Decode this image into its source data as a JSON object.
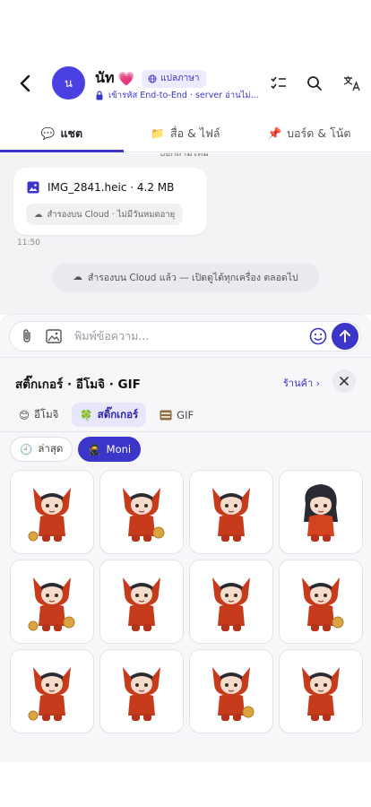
{
  "header": {
    "avatar_initial": "น",
    "contact_name": "นัท",
    "heart": "💗",
    "translate_label": "แปลภาษา",
    "encryption_text": "เข้ารหัส End-to-End · server อ่านไม่..."
  },
  "tabs": [
    {
      "icon": "💬",
      "label": "แชต"
    },
    {
      "icon": "📁",
      "label": "สื่อ & ไฟล์"
    },
    {
      "icon": "📌",
      "label": "บอร์ด & โน้ต"
    }
  ],
  "chat": {
    "cut_text": "บอกสามีไหม",
    "file_name": "IMG_2841.heic · 4.2 MB",
    "cloud_chip": "สำรองบน Cloud · ไม่มีวันหมดอายุ",
    "time": "11:50",
    "system_message": "สำรองบน Cloud แล้ว — เปิดดูได้ทุกเครื่อง ตลอดไป"
  },
  "composer": {
    "placeholder": "พิมพ์ข้อความ..."
  },
  "panel": {
    "title": "สติ๊กเกอร์ · อีโมจิ · GIF",
    "store_link": "ร้านค้า ›",
    "tabs": [
      {
        "icon": "😊",
        "label": "อีโมจิ"
      },
      {
        "icon": "🍀",
        "label": "สติ๊กเกอร์"
      },
      {
        "icon": "GIF-icon",
        "label": "GIF"
      }
    ],
    "packs": [
      {
        "icon": "🕘",
        "label": "ล่าสุด"
      },
      {
        "icon": "🥷",
        "label": "Moni"
      }
    ],
    "sticker_count": 12
  },
  "colors": {
    "accent": "#3b35c9",
    "accent_soft": "#e8e6fb",
    "chat_bg": "#f3f3f6"
  }
}
